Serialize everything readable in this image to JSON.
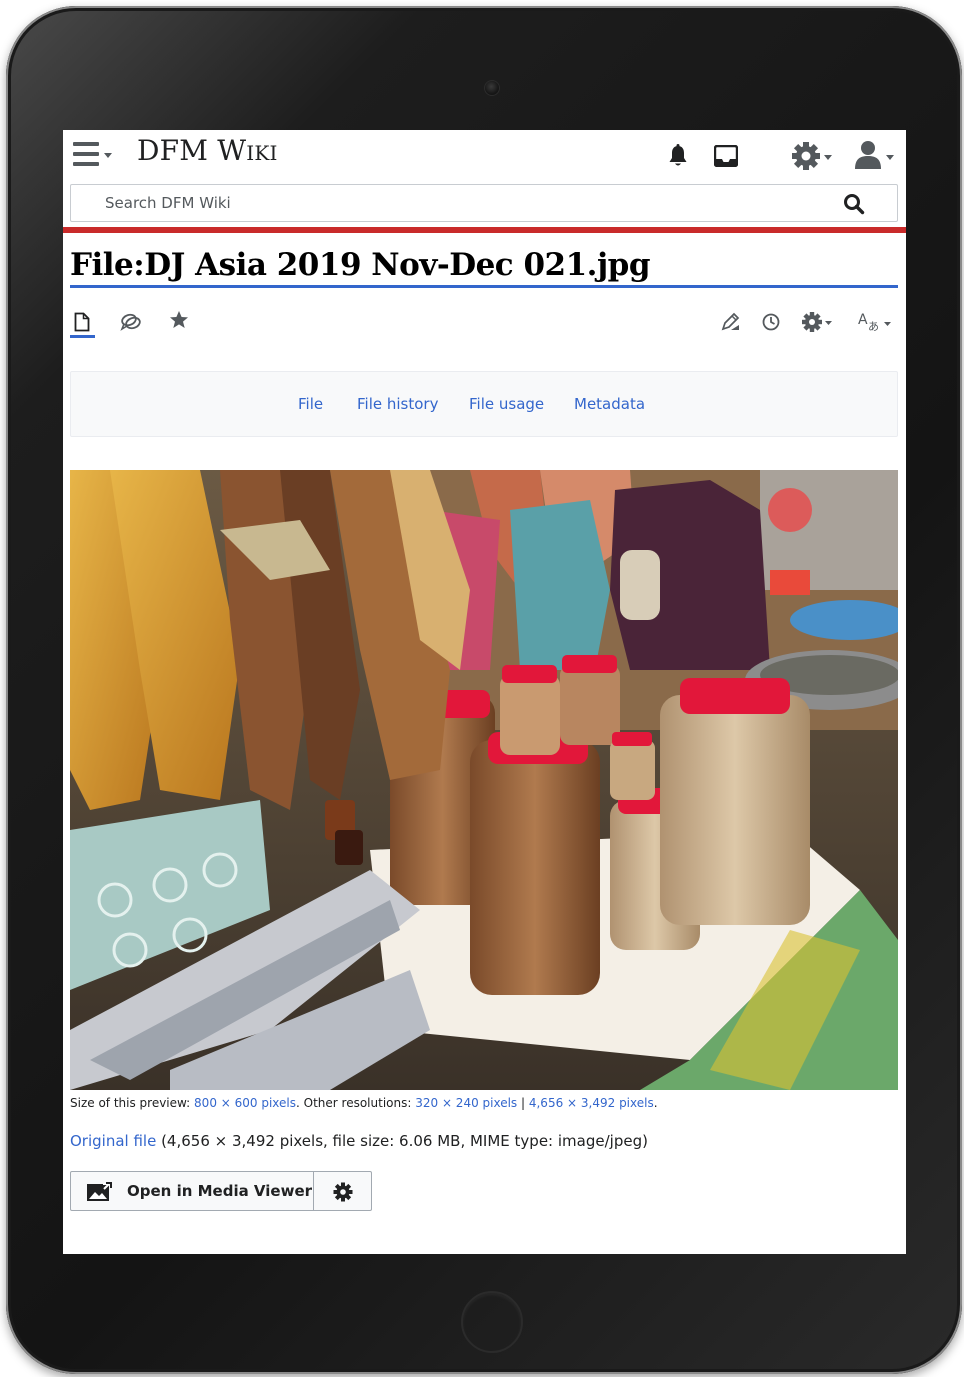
{
  "header": {
    "site_title": "DFM Wiki",
    "icons": [
      "menu-icon",
      "bell-icon",
      "tray-icon",
      "settings-icon",
      "user-icon"
    ]
  },
  "search": {
    "placeholder": "Search DFM Wiki",
    "value": ""
  },
  "page": {
    "title": "File:DJ Asia 2019 Nov-Dec 021.jpg"
  },
  "toolbar": {
    "left_icons": [
      "article-icon",
      "talk-icon",
      "watch-star-icon"
    ],
    "right_icons": [
      "edit-icon",
      "history-icon",
      "tools-icon",
      "language-icon"
    ]
  },
  "file_tabs": [
    "File",
    "File history",
    "File usage",
    "Metadata"
  ],
  "preview": {
    "prefix": "Size of this preview: ",
    "size": "800 × 600 pixels",
    "middle": ". Other resolutions: ",
    "res1": "320 × 240 pixels",
    "sep": " | ",
    "res2": "4,656 × 3,492 pixels",
    "suffix": "."
  },
  "original": {
    "link": "Original file",
    "details": " (4,656 × 3,492 pixels, file size: 6.06 MB, MIME type: image/jpeg)"
  },
  "media_viewer": {
    "open_label": "Open in Media Viewer"
  },
  "colors": {
    "accent_blue": "#3366cc",
    "header_rule_red": "#c92a2a",
    "text": "#202122",
    "icon_gray": "#54595d"
  }
}
